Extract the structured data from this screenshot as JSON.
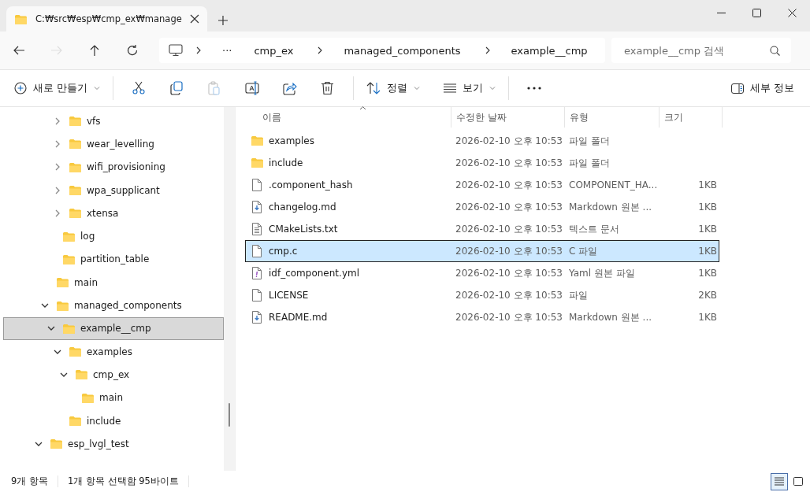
{
  "tab": {
    "title": "C:₩src₩esp₩cmp_ex₩manage"
  },
  "nav": [
    {
      "kind": "back",
      "disabled": false
    },
    {
      "kind": "forward",
      "disabled": true
    },
    {
      "kind": "up",
      "disabled": false
    },
    {
      "kind": "refresh",
      "disabled": false
    }
  ],
  "breadcrumb": {
    "overflow": "···",
    "parts": [
      "cmp_ex",
      "managed_components",
      "example__cmp"
    ]
  },
  "search": {
    "placeholder": "example__cmp 검색"
  },
  "toolbar": {
    "new_label": "새로 만들기",
    "actions": [
      {
        "kind": "cut",
        "disabled": false
      },
      {
        "kind": "copy",
        "disabled": false
      },
      {
        "kind": "paste",
        "disabled": true
      },
      {
        "kind": "rename",
        "disabled": false
      },
      {
        "kind": "share",
        "disabled": false
      },
      {
        "kind": "delete",
        "disabled": false
      }
    ],
    "sort_label": "정렬",
    "view_label": "보기",
    "details_label": "세부 정보"
  },
  "tree": [
    {
      "children": [
        {
          "children": [
            {
              "children": [
                {
                  "label": "vfs",
                  "expanded": false,
                  "selected": false
                },
                {
                  "label": "wear_levelling",
                  "expanded": false,
                  "selected": false
                },
                {
                  "label": "wifi_provisioning",
                  "expanded": false,
                  "selected": false
                },
                {
                  "label": "wpa_supplicant",
                  "expanded": false,
                  "selected": false
                },
                {
                  "label": "xtensa",
                  "expanded": false,
                  "selected": false
                }
              ]
            },
            {
              "label": "log",
              "selected": false
            },
            {
              "label": "partition_table",
              "selected": false
            }
          ]
        },
        {
          "label": "main",
          "selected": false
        },
        {
          "label": "managed_components",
          "expanded": true,
          "selected": false,
          "children": [
            {
              "label": "example__cmp",
              "expanded": true,
              "selected": true,
              "children": [
                {
                  "label": "examples",
                  "expanded": true,
                  "selected": false,
                  "children": [
                    {
                      "label": "cmp_ex",
                      "expanded": true,
                      "selected": false,
                      "children": [
                        {
                          "label": "main",
                          "selected": false
                        }
                      ]
                    }
                  ]
                },
                {
                  "label": "include",
                  "selected": false
                }
              ]
            }
          ]
        }
      ]
    },
    {
      "label": "esp_lvgl_test",
      "expanded": true,
      "selected": false
    }
  ],
  "table": {
    "columns": [
      "이름",
      "수정한 날짜",
      "유형",
      "크기"
    ],
    "rows": [
      {
        "kind": "folder",
        "name": "examples",
        "date": "2026-02-10 오후 10:53",
        "type": "파일 폴더",
        "selected": false
      },
      {
        "kind": "folder",
        "name": "include",
        "date": "2026-02-10 오후 10:53",
        "type": "파일 폴더",
        "selected": false
      },
      {
        "kind": "blank",
        "name": ".component_hash",
        "date": "2026-02-10 오후 10:53",
        "type": "COMPONENT_HA...",
        "size": "1KB",
        "selected": false
      },
      {
        "kind": "markdown",
        "name": "changelog.md",
        "date": "2026-02-10 오후 10:53",
        "type": "Markdown 원본 ...",
        "size": "1KB",
        "selected": false
      },
      {
        "kind": "text",
        "name": "CMakeLists.txt",
        "date": "2026-02-10 오후 10:53",
        "type": "텍스트 문서",
        "size": "1KB",
        "selected": false
      },
      {
        "kind": "blank",
        "name": "cmp.c",
        "date": "2026-02-10 오후 10:53",
        "type": "C 파일",
        "size": "1KB",
        "selected": true
      },
      {
        "kind": "yaml",
        "name": "idf_component.yml",
        "date": "2026-02-10 오후 10:53",
        "type": "Yaml 원본 파일",
        "size": "1KB",
        "selected": false
      },
      {
        "kind": "blank",
        "name": "LICENSE",
        "date": "2026-02-10 오후 10:53",
        "type": "파일",
        "size": "2KB",
        "selected": false
      },
      {
        "kind": "markdown",
        "name": "README.md",
        "date": "2026-02-10 오후 10:53",
        "type": "Markdown 원본 ...",
        "size": "1KB",
        "selected": false
      }
    ]
  },
  "status_bar": {
    "count": "9개 항목",
    "selection": "1개 항목 선택함 95바이트",
    "views": [
      {
        "kind": "details",
        "selected": true
      },
      {
        "kind": "tiles",
        "selected": false
      }
    ]
  }
}
